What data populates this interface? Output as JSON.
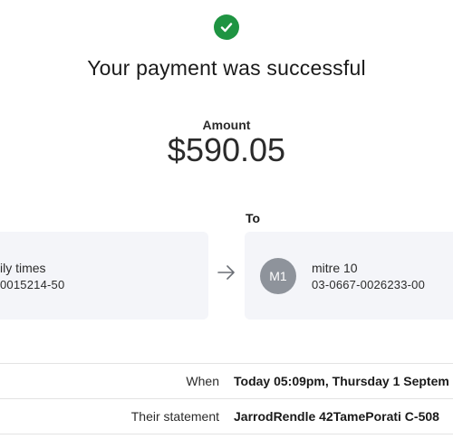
{
  "header": {
    "icon": "check-circle-icon",
    "title": "Your payment was successful",
    "accent_color": "#1f9442"
  },
  "amount": {
    "label": "Amount",
    "value": "$590.05"
  },
  "from_account": {
    "name": "ily times",
    "account": "0015214-50"
  },
  "to_account": {
    "section_label": "To",
    "avatar_initials": "M1",
    "name": "mitre 10",
    "account": "03-0667-0026233-00"
  },
  "details": [
    {
      "label": "When",
      "value": "Today 05:09pm, Thursday 1 Septem"
    },
    {
      "label": "Their statement",
      "value": "JarrodRendle 42TamePorati C-508"
    }
  ]
}
